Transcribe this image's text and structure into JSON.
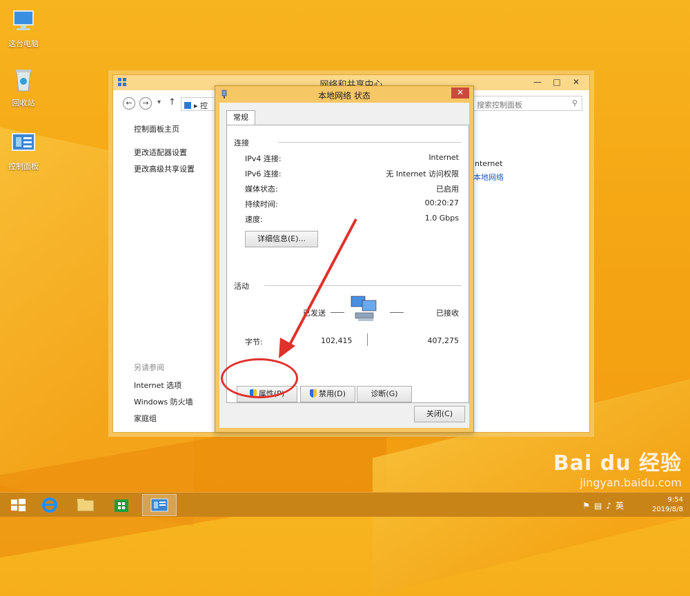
{
  "desktop": {
    "icons": [
      {
        "label": "这台电脑"
      },
      {
        "label": "回收站"
      },
      {
        "label": "控制面板"
      }
    ]
  },
  "control_panel": {
    "title": "网络和共享中心",
    "breadcrumb": "控",
    "search_placeholder": "搜索控制面板",
    "left_links": [
      "控制面板主页",
      "更改适配器设置",
      "更改高级共享设置"
    ],
    "see_also_label": "另请参阅",
    "see_also_links": [
      "Internet 选项",
      "Windows 防火墙",
      "家庭组"
    ],
    "right_text1": "nternet",
    "right_text2": "本地网络"
  },
  "dialog": {
    "title": "本地网络 状态",
    "close_glyph": "✕",
    "tab": "常规",
    "connection": {
      "group_title": "连接",
      "rows": [
        {
          "label": "IPv4 连接:",
          "value": "Internet"
        },
        {
          "label": "IPv6 连接:",
          "value": "无 Internet 访问权限"
        },
        {
          "label": "媒体状态:",
          "value": "已启用"
        },
        {
          "label": "持续时间:",
          "value": "00:20:27"
        },
        {
          "label": "速度:",
          "value": "1.0 Gbps"
        }
      ],
      "details_button": "详细信息(E)..."
    },
    "activity": {
      "group_title": "活动",
      "sent_label": "已发送",
      "received_label": "已接收",
      "bytes_label": "字节:",
      "bytes_sent": "102,415",
      "bytes_received": "407,275"
    },
    "buttons": {
      "properties": "属性(P)",
      "disable": "禁用(D)",
      "diagnose": "诊断(G)",
      "close": "关闭(C)"
    }
  },
  "taskbar": {
    "time": "9:54",
    "date": "2019/8/8",
    "ime": "英"
  },
  "watermark": {
    "line1": "Bai du 经验",
    "line2": "jingyan.baidu.com"
  },
  "colors": {
    "accent_red": "#e0312b",
    "dialog_frame": "#f6c765",
    "wallpaper": "#f5a714"
  }
}
